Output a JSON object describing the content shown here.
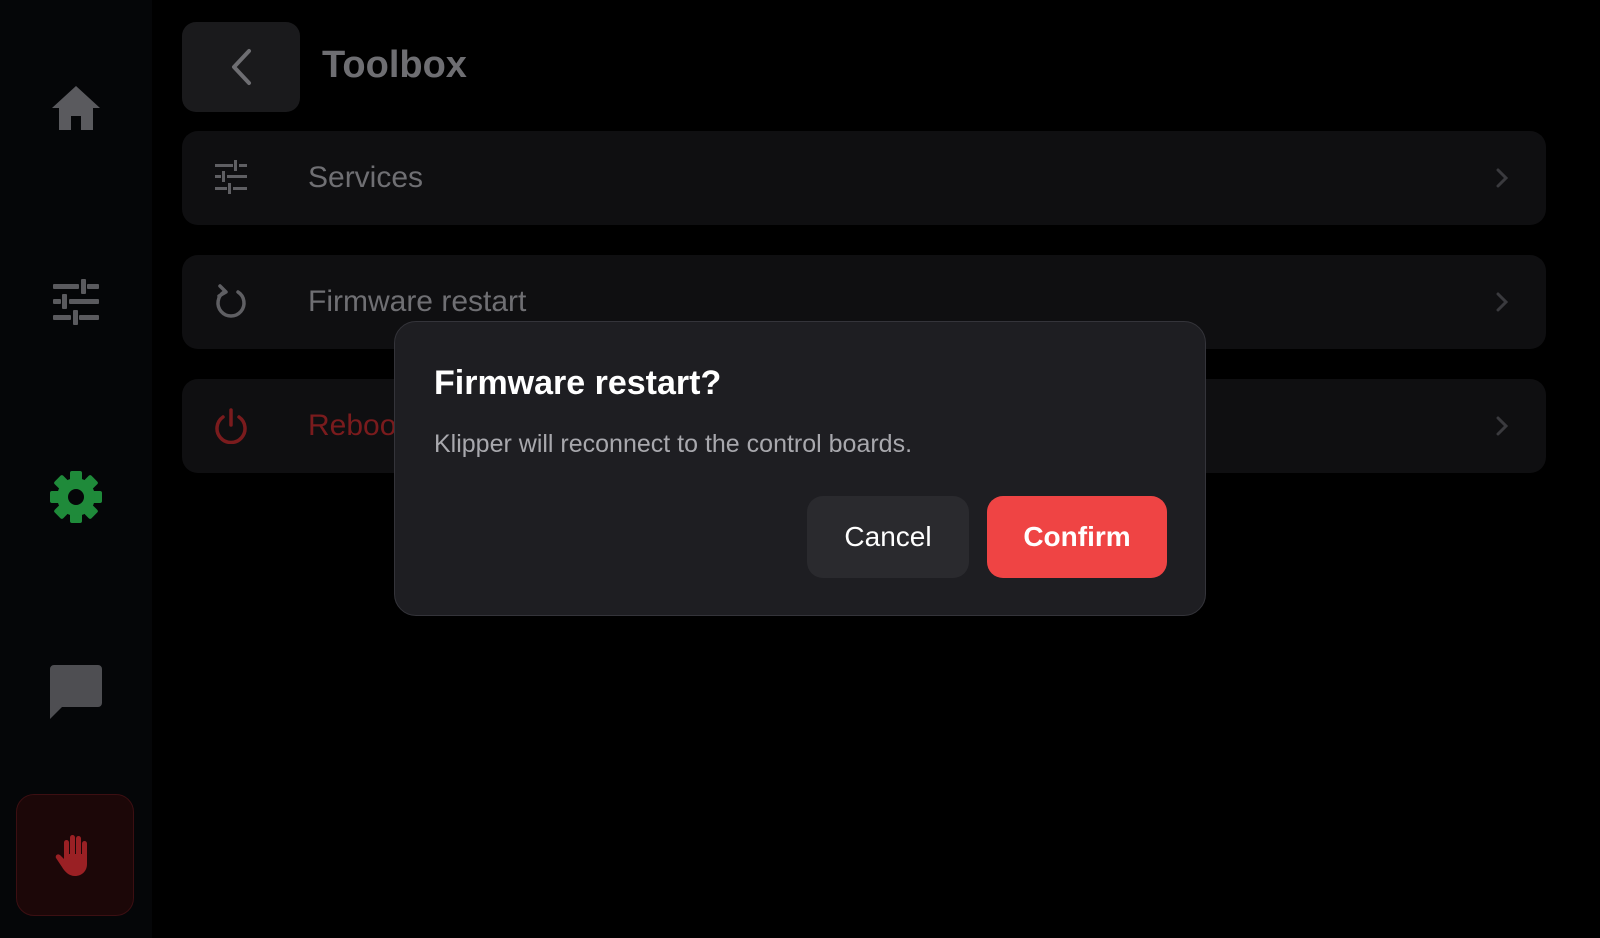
{
  "colors": {
    "accent_green": "#1f8a3a",
    "danger_red": "#ef4444",
    "modal_bg": "#1e1e22"
  },
  "sidebar": {
    "items": [
      {
        "icon": "home-icon"
      },
      {
        "icon": "sliders-icon"
      },
      {
        "icon": "gear-icon",
        "active": true
      },
      {
        "icon": "chat-icon"
      }
    ],
    "estop_icon": "hand-stop-icon"
  },
  "header": {
    "title": "Toolbox",
    "back_icon": "chevron-left-icon"
  },
  "menu": {
    "items": [
      {
        "label": "Services",
        "icon": "sliders-icon"
      },
      {
        "label": "Firmware restart",
        "icon": "restart-icon"
      },
      {
        "label": "Reboot p",
        "icon": "power-icon"
      }
    ]
  },
  "modal": {
    "title": "Firmware restart?",
    "message": "Klipper will reconnect to the control boards.",
    "cancel_label": "Cancel",
    "confirm_label": "Confirm"
  }
}
